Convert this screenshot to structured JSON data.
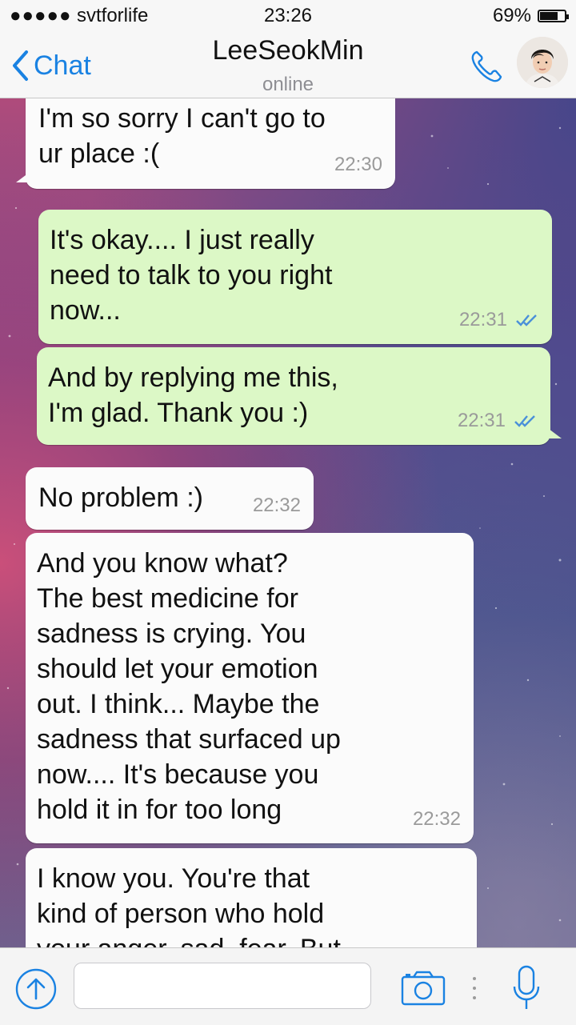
{
  "status_bar": {
    "signal": "●●●●●",
    "carrier": "svtforlife",
    "time": "23:26",
    "battery_percent": "69%",
    "battery_level": 0.69
  },
  "header": {
    "back_label": "Chat",
    "contact_name": "LeeSeokMin",
    "contact_status": "online",
    "call_icon": "phone-icon",
    "avatar_icon": "contact-avatar"
  },
  "messages": [
    {
      "direction": "incoming",
      "text": "I'm so sorry I can't go to\nur place :(",
      "time": "22:30"
    },
    {
      "direction": "outgoing",
      "text": "It's okay.... I just really\nneed to talk to you right\nnow...",
      "time": "22:31",
      "ticks": "double-check-icon"
    },
    {
      "direction": "outgoing",
      "text": "And by replying me this,\nI'm glad. Thank you :)",
      "time": "22:31",
      "ticks": "double-check-icon"
    },
    {
      "direction": "incoming",
      "text": "No problem :)",
      "time": "22:32"
    },
    {
      "direction": "incoming",
      "text": "And you know what?\nThe best medicine for\nsadness is crying. You\nshould let your emotion\nout. I think... Maybe the\nsadness that surfaced up\nnow.... It's because you\nhold it in for too long",
      "time": "22:32"
    },
    {
      "direction": "incoming",
      "text": "I know you. You're that\nkind of person who hold\nyour anger, sad, fear. But",
      "time": ""
    }
  ],
  "input_bar": {
    "message_value": "",
    "icons": [
      "upload-arrow-icon",
      "camera-icon",
      "more-dots-icon",
      "microphone-icon"
    ]
  },
  "colors": {
    "accent": "#1a82e2",
    "outgoing_bubble": "#dcf8c6",
    "incoming_bubble": "#fbfbfb"
  }
}
